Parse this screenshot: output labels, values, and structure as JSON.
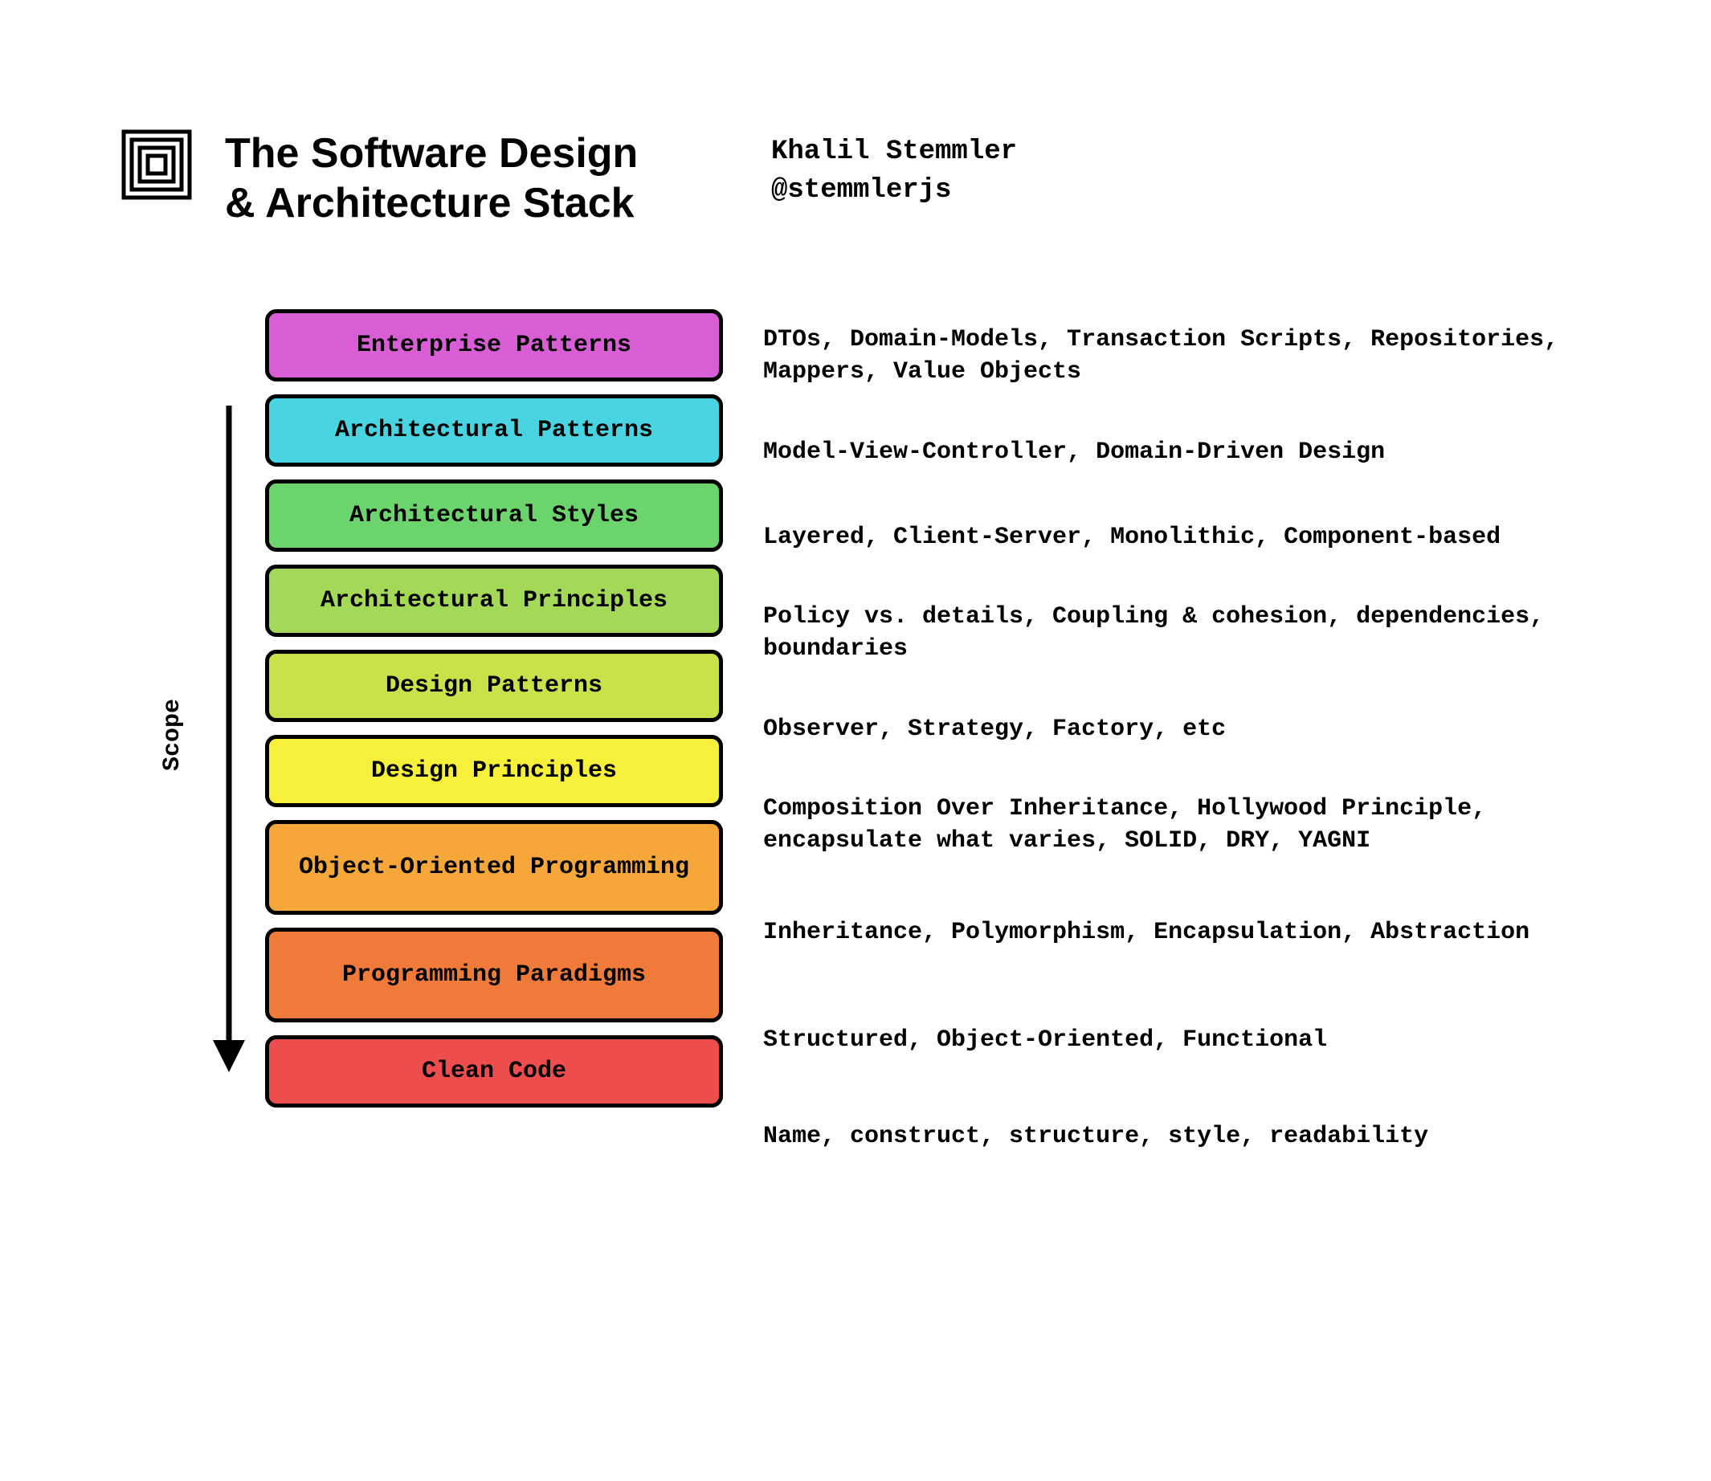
{
  "header": {
    "title_line1": "The Software Design",
    "title_line2": "& Architecture Stack",
    "author_name": "Khalil Stemmler",
    "author_handle": "@stemmlerjs"
  },
  "scope_label": "Scope",
  "layers": [
    {
      "label": "Enterprise Patterns",
      "description": "DTOs, Domain-Models, Transaction Scripts, Repositories, Mappers, Value Objects",
      "color": "#d95ed6",
      "tall": false
    },
    {
      "label": "Architectural Patterns",
      "description": "Model-View-Controller, Domain-Driven Design",
      "color": "#48d4e0",
      "tall": false
    },
    {
      "label": "Architectural Styles",
      "description": "Layered, Client-Server, Monolithic, Component-based",
      "color": "#6cd46c",
      "tall": false
    },
    {
      "label": "Architectural Principles",
      "description": "Policy vs. details, Coupling & cohesion, dependencies, boundaries",
      "color": "#a4d857",
      "tall": false
    },
    {
      "label": "Design Patterns",
      "description": "Observer, Strategy, Factory, etc",
      "color": "#c8e24a",
      "tall": false
    },
    {
      "label": "Design Principles",
      "description": "Composition Over Inheritance, Hollywood Principle, encapsulate what varies, SOLID, DRY, YAGNI",
      "color": "#f7f03a",
      "tall": false
    },
    {
      "label": "Object-Oriented Programming",
      "description": "Inheritance, Polymorphism, Encapsulation, Abstraction",
      "color": "#f5a73a",
      "tall": true
    },
    {
      "label": "Programming Paradigms",
      "description": "Structured, Object-Oriented, Functional",
      "color": "#f07a3a",
      "tall": true
    },
    {
      "label": "Clean Code",
      "description": "Name, construct, structure, style, readability",
      "color": "#ee4d4d",
      "tall": false
    }
  ]
}
